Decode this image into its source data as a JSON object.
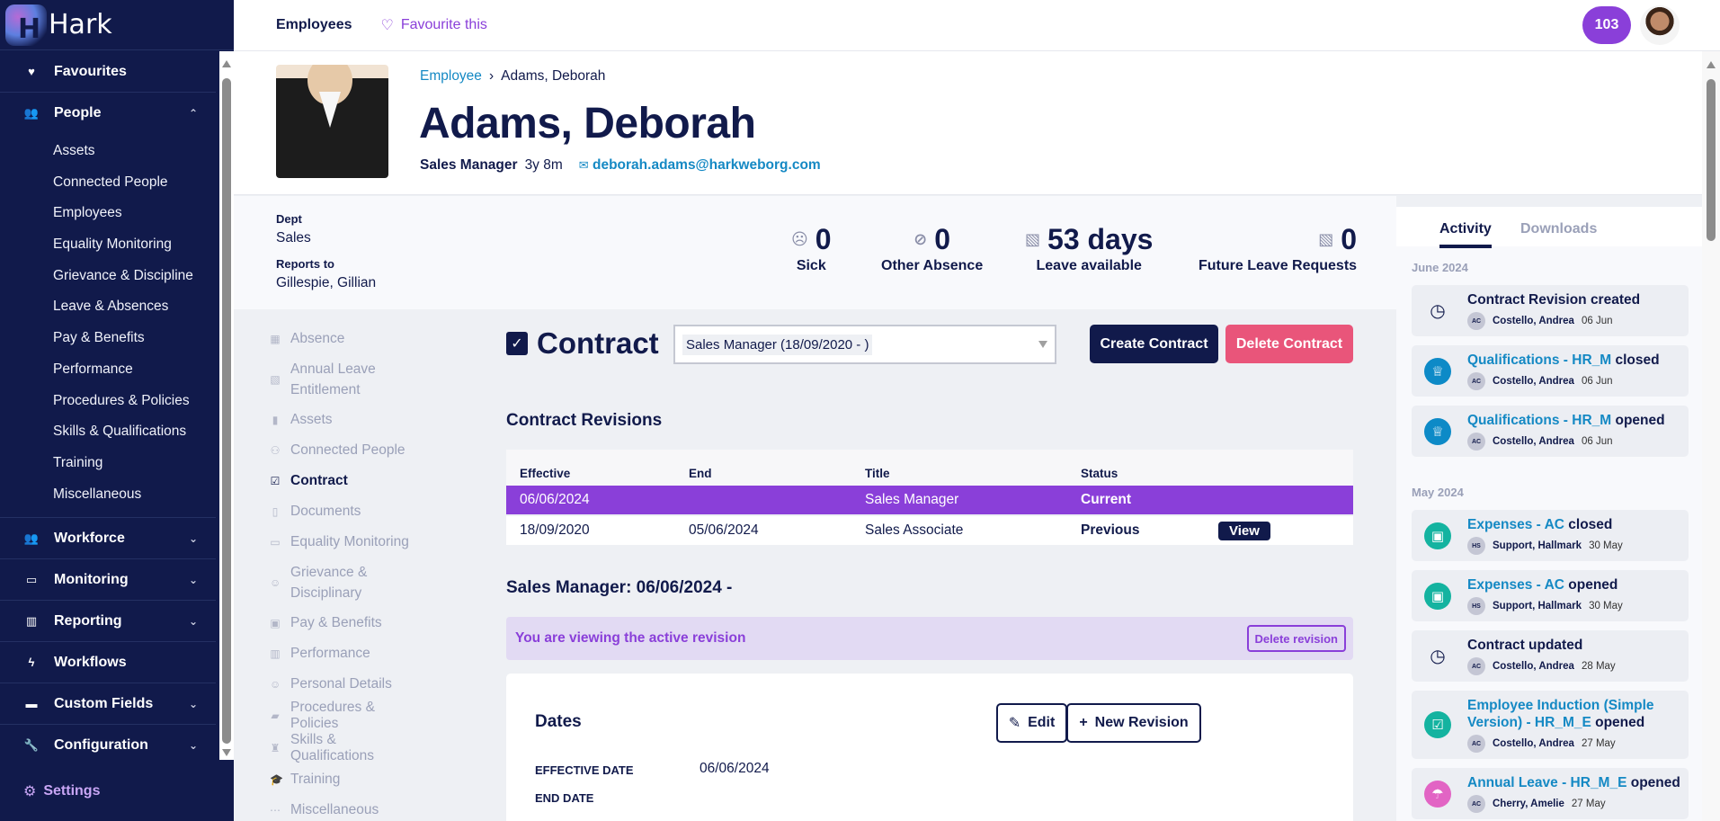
{
  "app": {
    "name": "Hark",
    "logo_letter": "H"
  },
  "sidebar": {
    "favourites": "Favourites",
    "people": {
      "label": "People",
      "items": [
        "Assets",
        "Connected People",
        "Employees",
        "Equality Monitoring",
        "Grievance & Discipline",
        "Leave & Absences",
        "Pay & Benefits",
        "Performance",
        "Procedures & Policies",
        "Skills & Qualifications",
        "Training",
        "Miscellaneous"
      ]
    },
    "sections": [
      {
        "label": "Workforce",
        "icon": "people-icon",
        "expandable": true
      },
      {
        "label": "Monitoring",
        "icon": "monitor-icon",
        "expandable": true
      },
      {
        "label": "Reporting",
        "icon": "chart-icon",
        "expandable": true
      },
      {
        "label": "Workflows",
        "icon": "bolt-icon",
        "expandable": false
      },
      {
        "label": "Custom Fields",
        "icon": "fields-icon",
        "expandable": true
      },
      {
        "label": "Configuration",
        "icon": "wrench-icon",
        "expandable": true
      }
    ],
    "settings": "Settings"
  },
  "topbar": {
    "section": "Employees",
    "favourite": "Favourite this",
    "notification_count": "103"
  },
  "employee": {
    "breadcrumb_parent": "Employee",
    "breadcrumb_sep": "›",
    "breadcrumb_current": "Adams, Deborah",
    "name": "Adams, Deborah",
    "role": "Sales Manager",
    "tenure": "3y 8m",
    "email": "deborah.adams@harkweborg.com",
    "dept_label": "Dept",
    "dept": "Sales",
    "reports_label": "Reports to",
    "reports_to": "Gillespie, Gillian"
  },
  "stats": [
    {
      "value": "0",
      "label": "Sick",
      "icon": "sick-face-icon"
    },
    {
      "value": "0",
      "label": "Other Absence",
      "icon": "absence-icon"
    },
    {
      "value": "53 days",
      "label": "Leave available",
      "icon": "suitcase-off-icon"
    },
    {
      "value": "0",
      "label": "Future Leave Requests",
      "icon": "suitcase-off-icon"
    }
  ],
  "subnav": [
    {
      "label": "Absence"
    },
    {
      "label": "Annual Leave Entitlement"
    },
    {
      "label": "Assets"
    },
    {
      "label": "Connected People"
    },
    {
      "label": "Contract",
      "active": true
    },
    {
      "label": "Documents"
    },
    {
      "label": "Equality Monitoring"
    },
    {
      "label": "Grievance & Disciplinary"
    },
    {
      "label": "Pay & Benefits"
    },
    {
      "label": "Performance"
    },
    {
      "label": "Personal Details"
    },
    {
      "label": "Procedures & Policies"
    },
    {
      "label": "Skills & Qualifications"
    },
    {
      "label": "Training"
    },
    {
      "label": "Miscellaneous"
    }
  ],
  "contract": {
    "title": "Contract",
    "selected": "Sales Manager (18/09/2020 - )",
    "create_label": "Create Contract",
    "delete_label": "Delete Contract",
    "revisions_heading": "Contract Revisions",
    "columns": [
      "Effective",
      "End",
      "Title",
      "Status"
    ],
    "rows": [
      {
        "effective": "06/06/2024",
        "end": "",
        "title": "Sales Manager",
        "status": "Current"
      },
      {
        "effective": "18/09/2020",
        "end": "05/06/2024",
        "title": "Sales Associate",
        "status": "Previous",
        "action": "View"
      }
    ],
    "revision_title": "Sales Manager: 06/06/2024 -",
    "notice": "You are viewing the active revision",
    "delete_revision": "Delete revision",
    "dates_heading": "Dates",
    "edit_label": "Edit",
    "new_revision_label": "New Revision",
    "effective_date_label": "EFFECTIVE DATE",
    "effective_date": "06/06/2024",
    "end_date_label": "END DATE",
    "end_date": ""
  },
  "activity": {
    "tabs": [
      "Activity",
      "Downloads"
    ],
    "groups": [
      {
        "month": "June 2024",
        "items": [
          {
            "link": "",
            "text": "Contract Revision created",
            "initials": "AC",
            "user": "Costello, Andrea",
            "date": "06 Jun",
            "icon": "clock-icon"
          },
          {
            "link": "Qualifications - HR_M",
            "text": "closed",
            "initials": "AC",
            "user": "Costello, Andrea",
            "date": "06 Jun",
            "icon": "medal-icon"
          },
          {
            "link": "Qualifications - HR_M",
            "text": "opened",
            "initials": "AC",
            "user": "Costello, Andrea",
            "date": "06 Jun",
            "icon": "medal-icon"
          }
        ]
      },
      {
        "month": "May 2024",
        "items": [
          {
            "link": "Expenses - AC",
            "text": "closed",
            "initials": "HS",
            "user": "Support, Hallmark",
            "date": "30 May",
            "icon": "wallet-icon"
          },
          {
            "link": "Expenses - AC",
            "text": "opened",
            "initials": "HS",
            "user": "Support, Hallmark",
            "date": "30 May",
            "icon": "wallet-icon"
          },
          {
            "link": "",
            "text": "Contract updated",
            "initials": "AC",
            "user": "Costello, Andrea",
            "date": "28 May",
            "icon": "clock-icon"
          },
          {
            "link": "Employee Induction (Simple Version) - HR_M_E",
            "text": "opened",
            "initials": "AC",
            "user": "Costello, Andrea",
            "date": "27 May",
            "icon": "clipboard-check-icon"
          },
          {
            "link": "Annual Leave - HR_M_E",
            "text": "opened",
            "initials": "AC",
            "user": "Cherry, Amelie",
            "date": "27 May",
            "icon": "umbrella-icon"
          }
        ]
      }
    ],
    "colors": {
      "medal": "#0d8ac7",
      "wallet": "#14b3a0",
      "clipboard": "#14b3a0",
      "umbrella": "#e264c4"
    }
  }
}
